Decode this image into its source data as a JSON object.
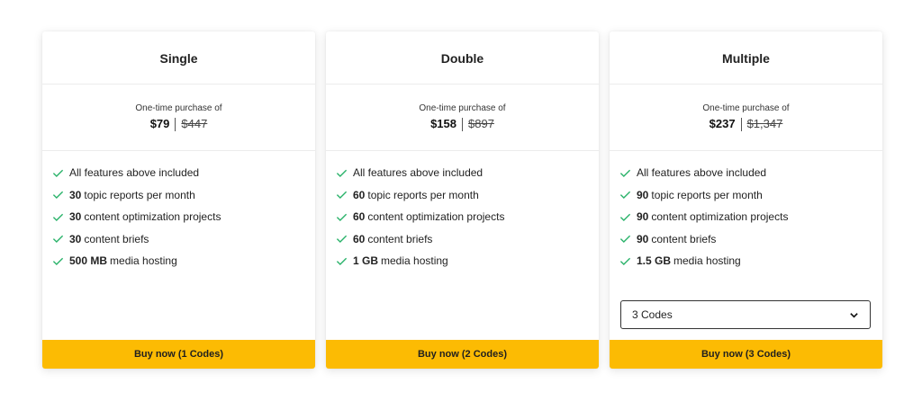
{
  "colors": {
    "accent": "#fcbb03",
    "check": "#2bb36b",
    "border": "#ececec"
  },
  "price_caption": "One-time purchase of",
  "plans": [
    {
      "name": "Single",
      "price": "$79",
      "old_price": "$447",
      "features": [
        {
          "bold": "",
          "text": "All features above included"
        },
        {
          "bold": "30",
          "text": "topic reports per month"
        },
        {
          "bold": "30",
          "text": "content optimization projects"
        },
        {
          "bold": "30",
          "text": "content briefs"
        },
        {
          "bold": "500 MB",
          "text": "media hosting"
        }
      ],
      "buy_label": "Buy now (1 Codes)"
    },
    {
      "name": "Double",
      "price": "$158",
      "old_price": "$897",
      "features": [
        {
          "bold": "",
          "text": "All features above included"
        },
        {
          "bold": "60",
          "text": "topic reports per month"
        },
        {
          "bold": "60",
          "text": "content optimization projects"
        },
        {
          "bold": "60",
          "text": "content briefs"
        },
        {
          "bold": "1 GB",
          "text": "media hosting"
        }
      ],
      "buy_label": "Buy now (2 Codes)"
    },
    {
      "name": "Multiple",
      "price": "$237",
      "old_price": "$1,347",
      "features": [
        {
          "bold": "",
          "text": "All features above included"
        },
        {
          "bold": "90",
          "text": "topic reports per month"
        },
        {
          "bold": "90",
          "text": "content optimization projects"
        },
        {
          "bold": "90",
          "text": "content briefs"
        },
        {
          "bold": "1.5 GB",
          "text": "media hosting"
        }
      ],
      "select_value": "3 Codes",
      "buy_label": "Buy now (3 Codes)"
    }
  ]
}
